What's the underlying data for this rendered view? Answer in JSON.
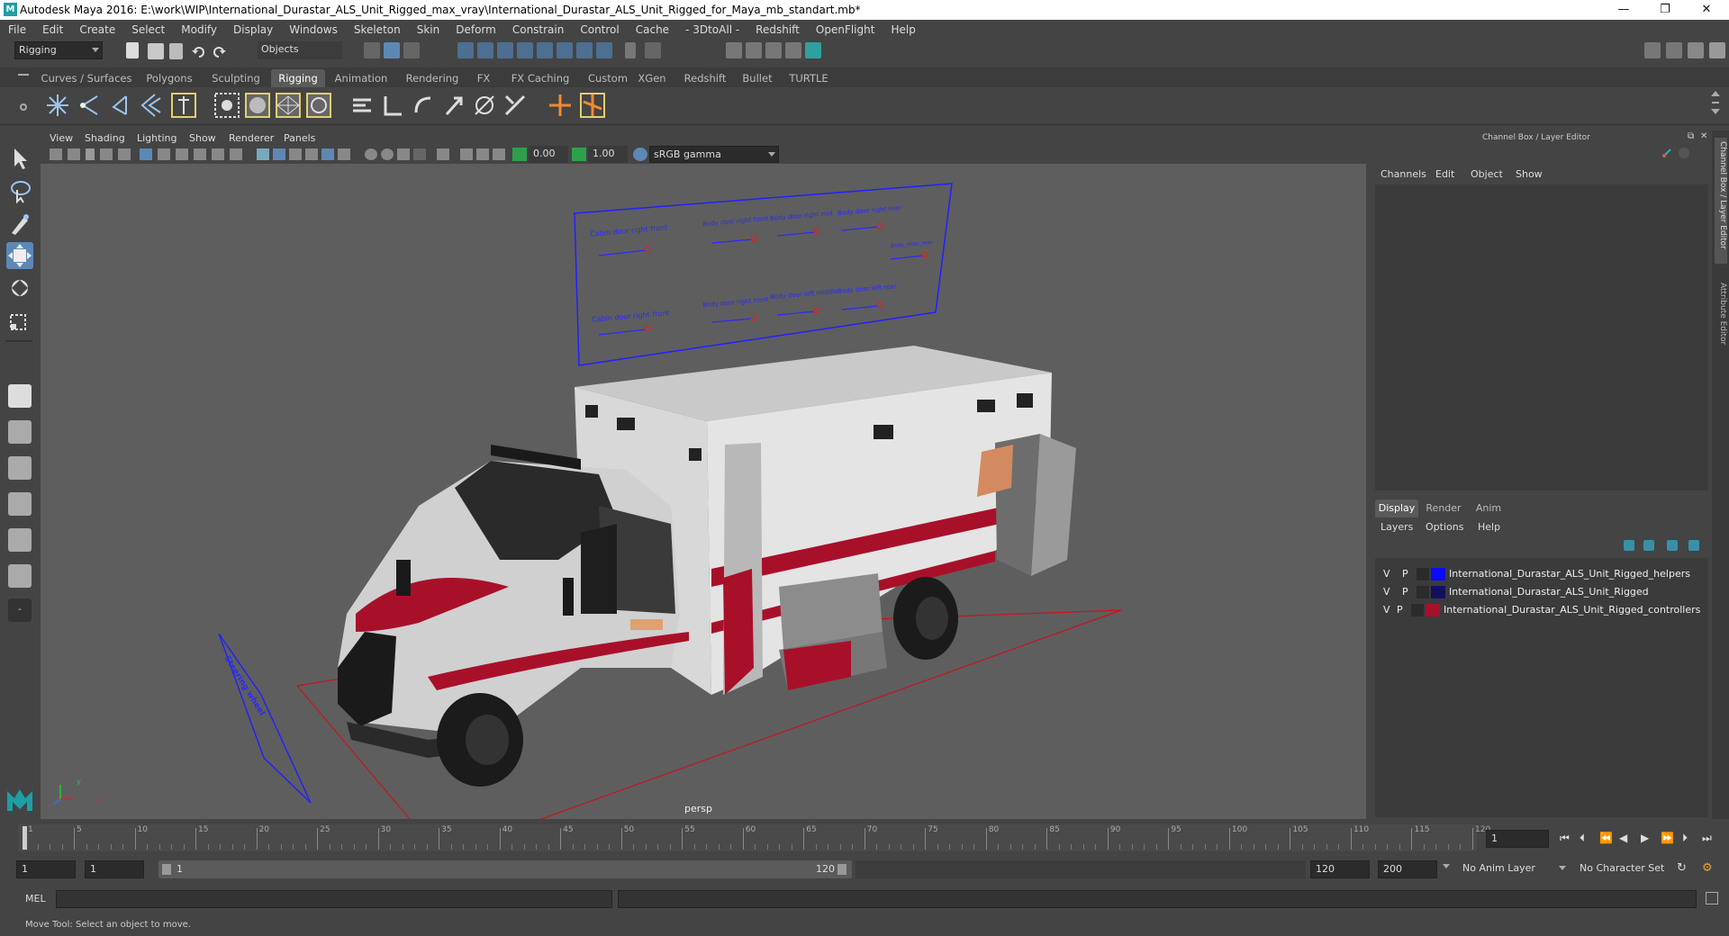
{
  "window": {
    "title": "Autodesk Maya 2016: E:\\work\\WIP\\International_Durastar_ALS_Unit_Rigged_max_vray\\International_Durastar_ALS_Unit_Rigged_for_Maya_mb_standart.mb*",
    "minimize": "—",
    "maximize": "❐",
    "close": "✕"
  },
  "menus": [
    "File",
    "Edit",
    "Create",
    "Select",
    "Modify",
    "Display",
    "Windows",
    "Skeleton",
    "Skin",
    "Deform",
    "Constrain",
    "Control",
    "Cache",
    "- 3DtoAll -",
    "Redshift",
    "OpenFlight",
    "Help"
  ],
  "status": {
    "mode": "Rigging",
    "selection_mode": "Objects"
  },
  "shelf_tabs": [
    "Curves / Surfaces",
    "Polygons",
    "Sculpting",
    "Rigging",
    "Animation",
    "Rendering",
    "FX",
    "FX Caching",
    "Custom",
    "XGen",
    "Redshift",
    "Bullet",
    "TURTLE"
  ],
  "active_shelf_tab": "Rigging",
  "panel_menu": [
    "View",
    "Shading",
    "Lighting",
    "Show",
    "Renderer",
    "Panels"
  ],
  "panel_toolbar": {
    "field_a": "0.00",
    "field_b": "1.00",
    "color_space": "sRGB gamma"
  },
  "viewport": {
    "camera_label": "persp",
    "axis_y": "y",
    "axis_x": "x",
    "controller_labels": [
      "Cabin door right front",
      "Body door right front",
      "Body door right mid",
      "Body door right rear",
      "Body_door_rear",
      "Cabin door right front",
      "Body door right front",
      "Body door left middle",
      "Body door left rear",
      "Steering wheel"
    ]
  },
  "channel_box": {
    "title": "Channel Box / Layer Editor",
    "menus": [
      "Channels",
      "Edit",
      "Object",
      "Show"
    ]
  },
  "layer_editor": {
    "tabs": [
      "Display",
      "Render",
      "Anim"
    ],
    "active_tab": "Display",
    "menus": [
      "Layers",
      "Options",
      "Help"
    ],
    "layers": [
      {
        "v": "V",
        "p": "P",
        "color": "#0a0aff",
        "name": "International_Durastar_ALS_Unit_Rigged_helpers"
      },
      {
        "v": "V",
        "p": "P",
        "color": "#101060",
        "name": "International_Durastar_ALS_Unit_Rigged"
      },
      {
        "v": "V",
        "p": "P",
        "color": "#a8102a",
        "name": "International_Durastar_ALS_Unit_Rigged_controllers"
      }
    ]
  },
  "side_tabs": [
    "Channel Box / Layer Editor",
    "Attribute Editor"
  ],
  "timeline": {
    "ticks": [
      "1",
      "5",
      "10",
      "15",
      "20",
      "25",
      "30",
      "35",
      "40",
      "45",
      "50",
      "55",
      "60",
      "65",
      "70",
      "75",
      "80",
      "85",
      "90",
      "95",
      "100",
      "105",
      "110",
      "115",
      "120"
    ],
    "current_frame": "1"
  },
  "range": {
    "start": "1",
    "inner_start": "1",
    "slider_start": "1",
    "slider_end": "120",
    "end": "120",
    "anim_end": "200",
    "anim_layer": "No Anim Layer",
    "character_set": "No Character Set"
  },
  "command_line": {
    "label": "MEL"
  },
  "help_line": "Move Tool: Select an object to move."
}
